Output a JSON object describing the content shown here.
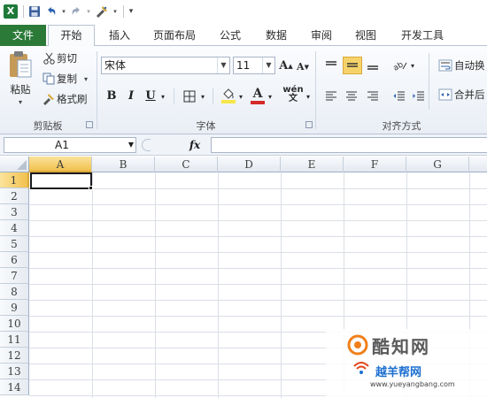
{
  "qat": {
    "icons": [
      "excel-logo-icon",
      "save-icon",
      "undo-icon",
      "redo-icon",
      "format-painter-icon",
      "customize-qat-icon"
    ],
    "excel_glyph": "X"
  },
  "tabs": [
    {
      "label": "文件",
      "active": false
    },
    {
      "label": "开始",
      "active": true
    },
    {
      "label": "插入",
      "active": false
    },
    {
      "label": "页面布局",
      "active": false
    },
    {
      "label": "公式",
      "active": false
    },
    {
      "label": "数据",
      "active": false
    },
    {
      "label": "审阅",
      "active": false
    },
    {
      "label": "视图",
      "active": false
    },
    {
      "label": "开发工具",
      "active": false
    }
  ],
  "ribbon": {
    "clipboard": {
      "paste_label": "粘贴",
      "cut_label": "剪切",
      "copy_label": "复制",
      "format_painter_label": "格式刷",
      "group_label": "剪贴板"
    },
    "font": {
      "font_name": "宋体",
      "font_size": "11",
      "bold": "B",
      "italic": "I",
      "underline": "U",
      "phonetic": "wén",
      "font_color_letter": "A",
      "group_label": "字体"
    },
    "alignment": {
      "wrap_text_label": "自动换",
      "merge_label": "合并后",
      "group_label": "对齐方式"
    }
  },
  "formula_bar": {
    "name_box": "A1",
    "fx_label": "fx",
    "value": ""
  },
  "grid": {
    "columns": [
      "A",
      "B",
      "C",
      "D",
      "E",
      "F",
      "G"
    ],
    "rows": [
      "1",
      "2",
      "3",
      "4",
      "5",
      "6",
      "7",
      "8",
      "9",
      "10",
      "11",
      "12",
      "13",
      "14"
    ],
    "active_cell": "A1"
  },
  "watermark": {
    "brand_cn": "酷知网",
    "brand2_cn": "越羊帮网",
    "url": "www.yueyangbang.com"
  },
  "colors": {
    "file_tab": "#2b7a38",
    "active_align_button": "#f6d36a",
    "fill_color_bar": "#f7e64a",
    "font_color_bar": "#d42a2a",
    "header_highlight": "#f2c14e"
  }
}
